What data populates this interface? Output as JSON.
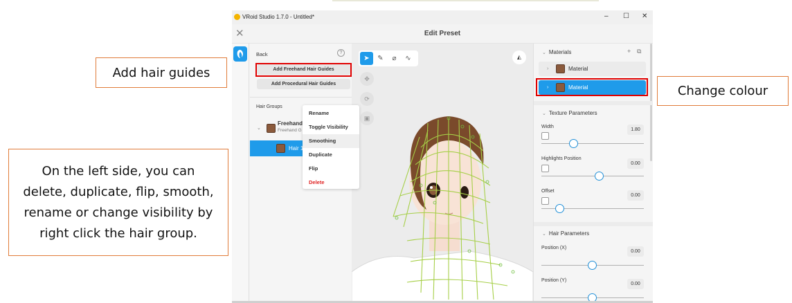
{
  "callouts": {
    "add_hair_guides": "Add hair guides",
    "change_colour": "Change colour",
    "left_side_note": "On the left side, you can delete, duplicate, flip, smooth, rename or change visibility by right click the hair group."
  },
  "window": {
    "title": "VRoid Studio 1.7.0 - Untitled*",
    "minimize_icon": "minimize-icon",
    "maximize_icon": "maximize-icon",
    "close_icon": "close-icon"
  },
  "header": {
    "title": "Edit Preset",
    "close_glyph": "✕"
  },
  "left_panel": {
    "back_label": "Back",
    "help_glyph": "?",
    "add_freehand_label": "Add Freehand Hair Guides",
    "add_procedural_label": "Add Procedural Hair Guides",
    "hair_groups_label": "Hair Groups",
    "group_name": "Freehand",
    "group_sub": "Freehand G",
    "child_name": "Hair 1",
    "group_color": "#8b5a3c"
  },
  "context_menu": {
    "items": [
      "Rename",
      "Toggle Visibility",
      "Smoothing",
      "Duplicate",
      "Flip",
      "Delete"
    ],
    "highlighted": "Smoothing"
  },
  "viewport": {
    "tools": [
      "select-cursor-icon",
      "pen-icon",
      "eraser-icon",
      "hair-guide-icon"
    ],
    "active_tool": "select-cursor-icon",
    "mesh_color": "#a6cf47"
  },
  "right_panel": {
    "materials_label": "Materials",
    "material_rows": [
      {
        "label": "Material",
        "selected": false
      },
      {
        "label": "Material",
        "selected": true
      }
    ],
    "texture_parameters_label": "Texture Parameters",
    "texture_params": [
      {
        "label": "Width",
        "value": "1.80",
        "fraction": 0.3
      },
      {
        "label": "Highlights Position",
        "value": "0.00",
        "fraction": 0.5
      },
      {
        "label": "Offset",
        "value": "0.00",
        "fraction": 0.0
      }
    ],
    "hair_parameters_label": "Hair Parameters",
    "hair_params": [
      {
        "label": "Position (X)",
        "value": "0.00",
        "fraction": 0.5
      },
      {
        "label": "Position (Y)",
        "value": "0.00",
        "fraction": 0.5
      }
    ],
    "accent_color": "#1f9bea"
  }
}
